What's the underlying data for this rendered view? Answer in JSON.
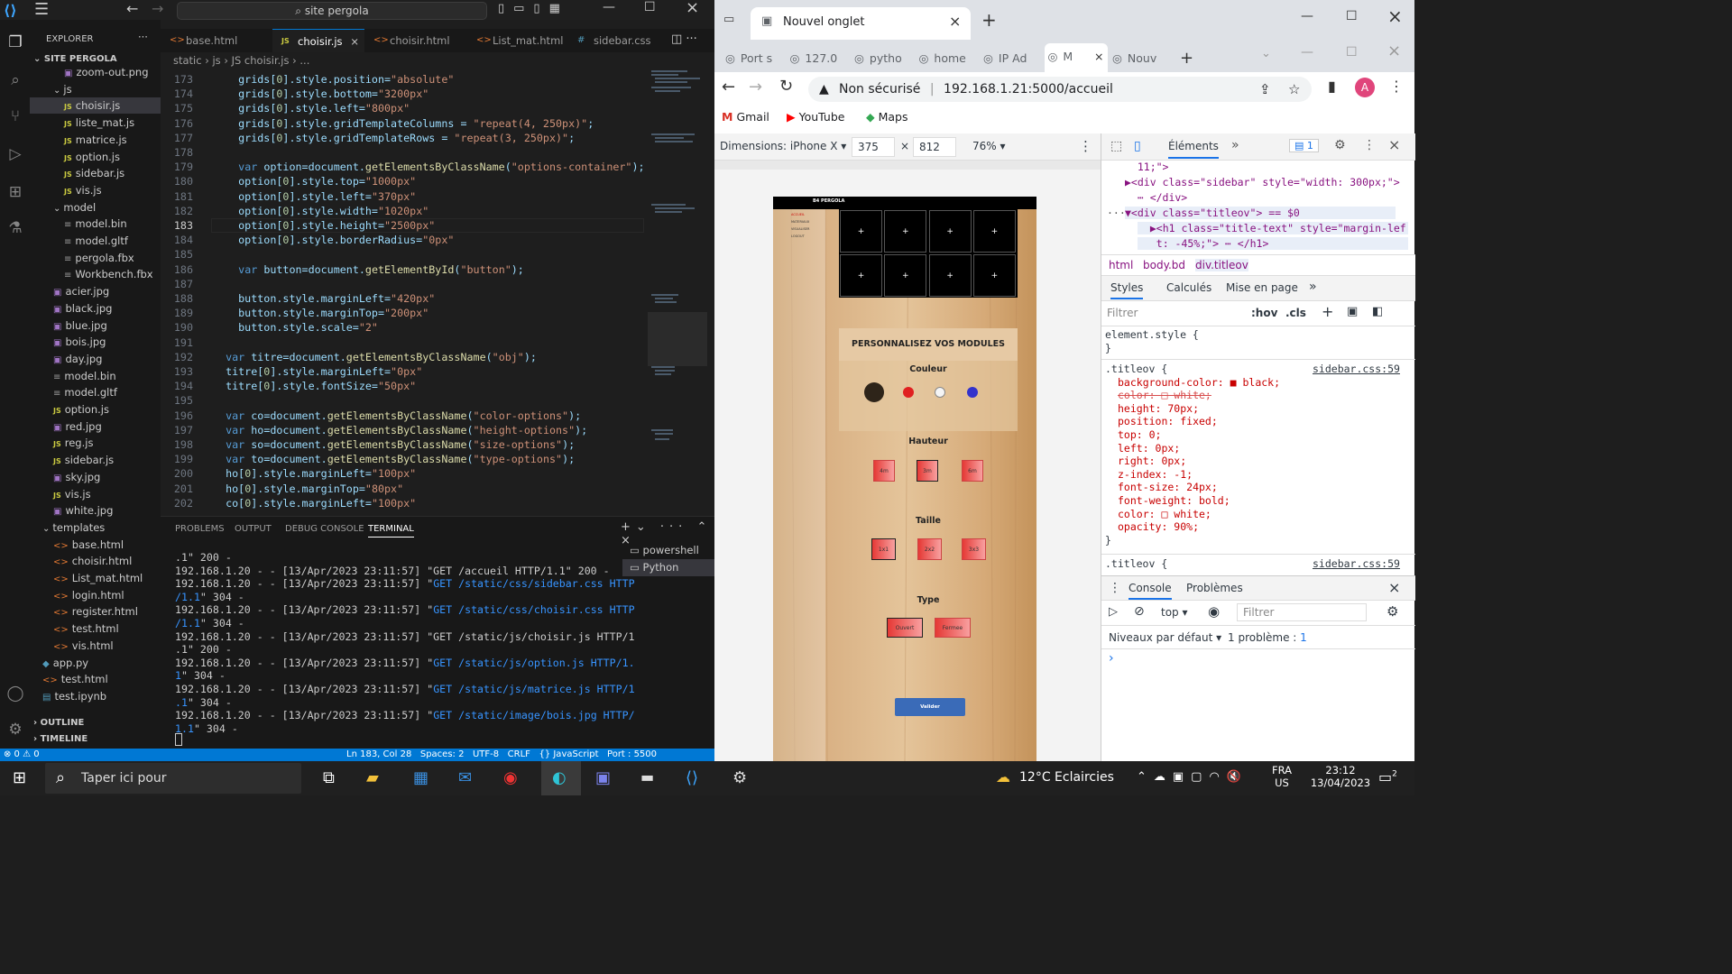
{
  "vscode": {
    "search": "site pergola",
    "sidebar": {
      "title": "EXPLORER",
      "root": "SITE PERGOLA",
      "items": [
        {
          "label": "zoom-out.png",
          "type": "img",
          "indent": 2
        },
        {
          "label": "js",
          "type": "folder",
          "indent": 1
        },
        {
          "label": "choisir.js",
          "type": "js",
          "indent": 2,
          "selected": true
        },
        {
          "label": "liste_mat.js",
          "type": "js",
          "indent": 2
        },
        {
          "label": "matrice.js",
          "type": "js",
          "indent": 2
        },
        {
          "label": "option.js",
          "type": "js",
          "indent": 2
        },
        {
          "label": "sidebar.js",
          "type": "js",
          "indent": 2
        },
        {
          "label": "vis.js",
          "type": "js",
          "indent": 2
        },
        {
          "label": "model",
          "type": "folder",
          "indent": 1
        },
        {
          "label": "model.bin",
          "type": "gen",
          "indent": 2
        },
        {
          "label": "model.gltf",
          "type": "gen",
          "indent": 2
        },
        {
          "label": "pergola.fbx",
          "type": "gen",
          "indent": 2
        },
        {
          "label": "Workbench.fbx",
          "type": "gen",
          "indent": 2
        },
        {
          "label": "acier.jpg",
          "type": "img",
          "indent": 1
        },
        {
          "label": "black.jpg",
          "type": "img",
          "indent": 1
        },
        {
          "label": "blue.jpg",
          "type": "img",
          "indent": 1
        },
        {
          "label": "bois.jpg",
          "type": "img",
          "indent": 1
        },
        {
          "label": "day.jpg",
          "type": "img",
          "indent": 1
        },
        {
          "label": "model.bin",
          "type": "gen",
          "indent": 1
        },
        {
          "label": "model.gltf",
          "type": "gen",
          "indent": 1
        },
        {
          "label": "option.js",
          "type": "js",
          "indent": 1
        },
        {
          "label": "red.jpg",
          "type": "img",
          "indent": 1
        },
        {
          "label": "reg.js",
          "type": "js",
          "indent": 1
        },
        {
          "label": "sidebar.js",
          "type": "js",
          "indent": 1
        },
        {
          "label": "sky.jpg",
          "type": "img",
          "indent": 1
        },
        {
          "label": "vis.js",
          "type": "js",
          "indent": 1
        },
        {
          "label": "white.jpg",
          "type": "img",
          "indent": 1
        },
        {
          "label": "templates",
          "type": "folder",
          "indent": 0
        },
        {
          "label": "base.html",
          "type": "htm",
          "indent": 1
        },
        {
          "label": "choisir.html",
          "type": "htm",
          "indent": 1
        },
        {
          "label": "List_mat.html",
          "type": "htm",
          "indent": 1
        },
        {
          "label": "login.html",
          "type": "htm",
          "indent": 1
        },
        {
          "label": "register.html",
          "type": "htm",
          "indent": 1
        },
        {
          "label": "test.html",
          "type": "htm",
          "indent": 1
        },
        {
          "label": "vis.html",
          "type": "htm",
          "indent": 1
        },
        {
          "label": "app.py",
          "type": "py",
          "indent": 0
        },
        {
          "label": "test.html",
          "type": "htm",
          "indent": 0
        },
        {
          "label": "test.ipynb",
          "type": "nb",
          "indent": 0
        }
      ],
      "outline": "OUTLINE",
      "timeline": "TIMELINE"
    },
    "tabs": [
      {
        "label": "base.html",
        "type": "htm"
      },
      {
        "label": "choisir.js",
        "type": "js",
        "active": true
      },
      {
        "label": "choisir.html",
        "type": "htm"
      },
      {
        "label": "List_mat.html",
        "type": "htm"
      },
      {
        "label": "sidebar.css",
        "type": "css"
      }
    ],
    "breadcrumb": "static  ›  js  ›  JS choisir.js  ›  ...",
    "code": [
      {
        "n": "173",
        "t": "    grids[0].style.position=\"absolute\""
      },
      {
        "n": "174",
        "t": "    grids[0].style.bottom=\"3200px\""
      },
      {
        "n": "175",
        "t": "    grids[0].style.left=\"800px\""
      },
      {
        "n": "176",
        "t": "    grids[0].style.gridTemplateColumns = \"repeat(4, 250px)\";"
      },
      {
        "n": "177",
        "t": "    grids[0].style.gridTemplateRows = \"repeat(3, 250px)\";"
      },
      {
        "n": "178",
        "t": ""
      },
      {
        "n": "179",
        "t": "    var option=document.getElementsByClassName(\"options-container\");"
      },
      {
        "n": "180",
        "t": "    option[0].style.top=\"1000px\""
      },
      {
        "n": "181",
        "t": "    option[0].style.left=\"370px\""
      },
      {
        "n": "182",
        "t": "    option[0].style.width=\"1020px\""
      },
      {
        "n": "183",
        "t": "    option[0].style.height=\"2500px\""
      },
      {
        "n": "184",
        "t": "    option[0].style.borderRadius=\"0px\""
      },
      {
        "n": "185",
        "t": ""
      },
      {
        "n": "186",
        "t": "    var button=document.getElementById(\"button\");"
      },
      {
        "n": "187",
        "t": ""
      },
      {
        "n": "188",
        "t": "    button.style.marginLeft=\"420px\""
      },
      {
        "n": "189",
        "t": "    button.style.marginTop=\"200px\""
      },
      {
        "n": "190",
        "t": "    button.style.scale=\"2\""
      },
      {
        "n": "191",
        "t": ""
      },
      {
        "n": "192",
        "t": "  var titre=document.getElementsByClassName(\"obj\");"
      },
      {
        "n": "193",
        "t": "  titre[0].style.marginLeft=\"0px\""
      },
      {
        "n": "194",
        "t": "  titre[0].style.fontSize=\"50px\""
      },
      {
        "n": "195",
        "t": ""
      },
      {
        "n": "196",
        "t": "  var co=document.getElementsByClassName(\"color-options\");"
      },
      {
        "n": "197",
        "t": "  var ho=document.getElementsByClassName(\"height-options\");"
      },
      {
        "n": "198",
        "t": "  var so=document.getElementsByClassName(\"size-options\");"
      },
      {
        "n": "199",
        "t": "  var to=document.getElementsByClassName(\"type-options\");"
      },
      {
        "n": "200",
        "t": "  ho[0].style.marginLeft=\"100px\""
      },
      {
        "n": "201",
        "t": "  ho[0].style.marginTop=\"80px\""
      },
      {
        "n": "202",
        "t": "  co[0].style.marginLeft=\"100px\""
      }
    ],
    "current_line": "183",
    "panel_tabs": [
      "PROBLEMS",
      "OUTPUT",
      "DEBUG CONSOLE",
      "TERMINAL"
    ],
    "terminal": [
      {
        "pre": ".1\" 200 -",
        "get": "",
        "post": ""
      },
      {
        "pre": "192.168.1.20 - - [13/Apr/2023 23:11:57] \"GET /accueil HTTP/1.1\" 200 -",
        "get": "",
        "post": ""
      },
      {
        "pre": "192.168.1.20 - - [13/Apr/2023 23:11:57] \"",
        "get": "GET /static/css/sidebar.css HTTP",
        "post": ""
      },
      {
        "pre": "",
        "get": "/1.1",
        "post": "\" 304 -"
      },
      {
        "pre": "192.168.1.20 - - [13/Apr/2023 23:11:57] \"",
        "get": "GET /static/css/choisir.css HTTP",
        "post": ""
      },
      {
        "pre": "",
        "get": "/1.1",
        "post": "\" 304 -"
      },
      {
        "pre": "192.168.1.20 - - [13/Apr/2023 23:11:57] \"GET /static/js/choisir.js HTTP/1",
        "get": "",
        "post": ""
      },
      {
        "pre": ".1\" 200 -",
        "get": "",
        "post": ""
      },
      {
        "pre": "192.168.1.20 - - [13/Apr/2023 23:11:57] \"",
        "get": "GET /static/js/option.js HTTP/1.",
        "post": ""
      },
      {
        "pre": "",
        "get": "1",
        "post": "\" 304 -"
      },
      {
        "pre": "192.168.1.20 - - [13/Apr/2023 23:11:57] \"",
        "get": "GET /static/js/matrice.js HTTP/1",
        "post": ""
      },
      {
        "pre": "",
        "get": ".1",
        "post": "\" 304 -"
      },
      {
        "pre": "192.168.1.20 - - [13/Apr/2023 23:11:57] \"",
        "get": "GET /static/image/bois.jpg HTTP/",
        "post": ""
      },
      {
        "pre": "",
        "get": "1.1",
        "post": "\" 304 -"
      }
    ],
    "terminals": [
      "powershell",
      "Python"
    ],
    "status_left": "⊗ 0 ⚠ 0",
    "status_right": "Ln 183, Col 28   Spaces: 2   UTF-8   CRLF   {} JavaScript   Port : 5500"
  },
  "chrome": {
    "window_tab": "Nouvel onglet",
    "tabs": [
      "Port s",
      "127.0",
      "pytho",
      "home",
      "IP Ad",
      "M",
      "Nouv"
    ],
    "security": "Non sécurisé",
    "url": "192.168.1.21:5000/accueil",
    "avatar": "A",
    "bookmarks": [
      "Gmail",
      "YouTube",
      "Maps"
    ],
    "device_toolbar": {
      "label": "Dimensions: iPhone X",
      "width": "375",
      "height": "812",
      "zoom": "76%"
    },
    "page": {
      "nav_title": "B4 PERGOLA",
      "nav_items": [
        "ACCUEIL",
        "MATERIAUX",
        "VISUALISER",
        "LOGOUT"
      ],
      "title": "PERSONNALISEZ VOS MODULES",
      "sections": {
        "couleur": "Couleur",
        "hauteur": "Hauteur",
        "taille": "Taille",
        "type": "Type"
      },
      "colors": [
        "#2e2419",
        "#e02020",
        "#f5f5f5",
        "#3333cc"
      ],
      "heights": [
        "4m",
        "3m",
        "6m"
      ],
      "sizes": [
        "1x1",
        "2x2",
        "3x3"
      ],
      "types": [
        "Ouvert",
        "Fermee"
      ],
      "validate": "Valider"
    },
    "devtools": {
      "tab_elements": "Éléments",
      "issues_badge": "1",
      "dom": [
        "  11;\">",
        "▶<div class=\"sidebar\" style=\"width: 300px;\">",
        "  ⋯ </div>",
        "▼<div class=\"titleov\"> == $0",
        "  ▶<h1 class=\"title-text\" style=\"margin-lef",
        "   t: -45%;\"> ⋯ </h1>"
      ],
      "crumbs": [
        "html",
        "body.bd",
        "div.titleov"
      ],
      "style_tabs": [
        "Styles",
        "Calculés",
        "Mise en page"
      ],
      "filter": "Filtrer",
      "hov": ":hov",
      "cls": ".cls",
      "element_style": "element.style {",
      "rule_selector": ".titleov {",
      "rule_source": "sidebar.css:59",
      "props": [
        "background-color: ■ black;",
        "color: □ white;",
        "height: 70px;",
        "position: fixed;",
        "top: 0;",
        "left: 0px;",
        "right: 0px;",
        "z-index: -1;",
        "font-size: 24px;",
        "font-weight: bold;",
        "color: □ white;",
        "opacity: 90%;"
      ],
      "rule2_selector": ".titleov {",
      "rule2_source": "sidebar.css:59",
      "console_tabs": [
        "Console",
        "Problèmes"
      ],
      "context": "top",
      "console_filter": "Filtrer",
      "levels": "Niveaux par défaut",
      "problems": "1 problème :",
      "problems_count": "1"
    }
  },
  "taskbar": {
    "search": "Taper ici pour",
    "weather": "12°C  Eclaircies",
    "lang1": "FRA",
    "lang2": "US",
    "time": "23:12",
    "date": "13/04/2023",
    "notif": "2"
  }
}
